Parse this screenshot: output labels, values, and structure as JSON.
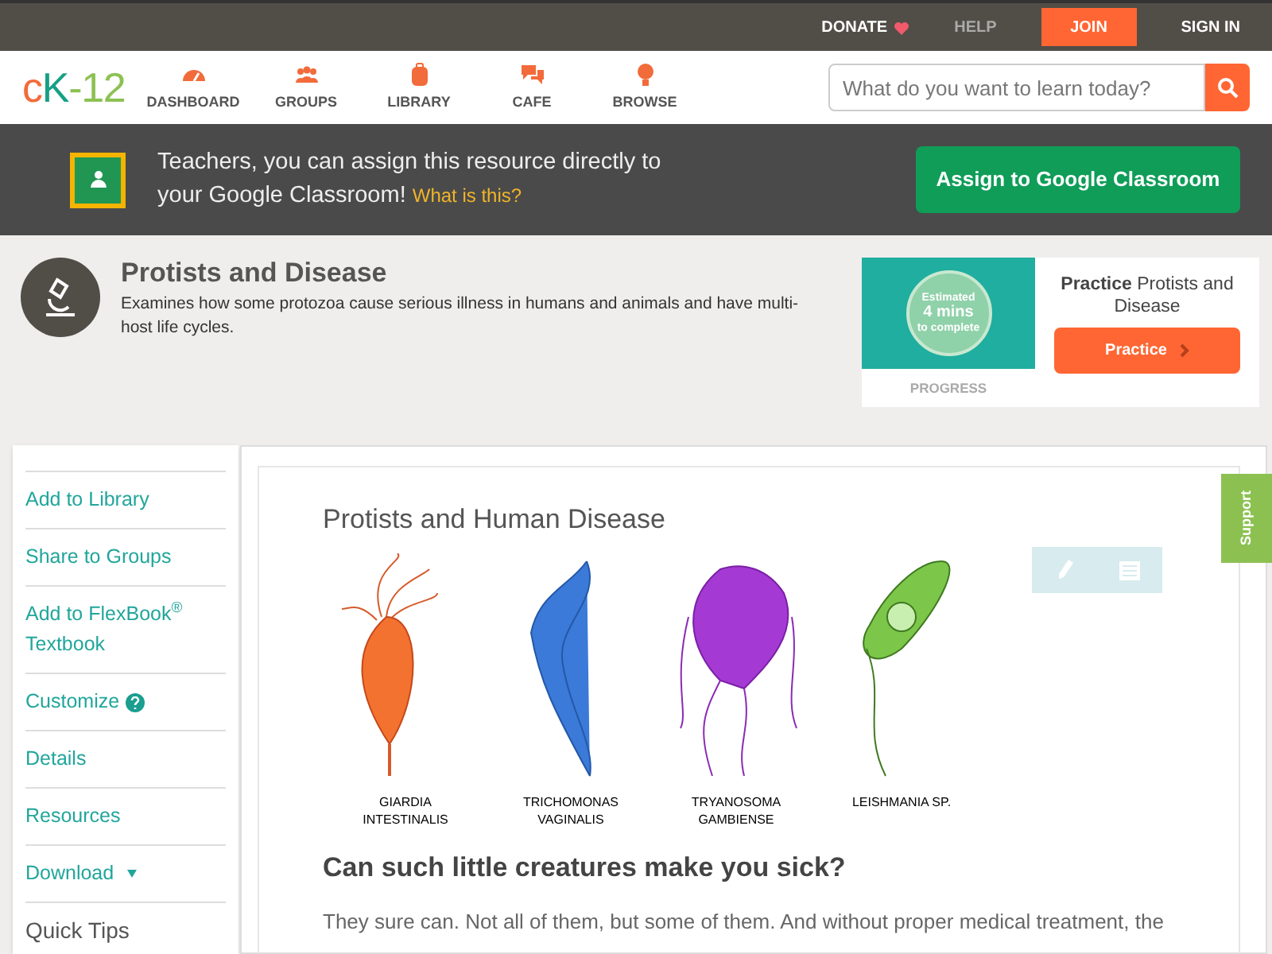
{
  "top_bar": {
    "links": [
      {
        "kind": "donate",
        "label": "DONATE"
      },
      {
        "kind": "help",
        "label": "HELP"
      },
      {
        "kind": "join",
        "label": "JOIN"
      },
      {
        "kind": "signin",
        "label": "SIGN IN"
      }
    ]
  },
  "nav": {
    "logo": [
      "c",
      "K",
      "-12"
    ],
    "items": [
      {
        "kind": "dashboard",
        "label": "DASHBOARD"
      },
      {
        "kind": "groups",
        "label": "GROUPS"
      },
      {
        "kind": "library",
        "label": "LIBRARY"
      },
      {
        "kind": "cafe",
        "label": "CAFE"
      },
      {
        "kind": "browse",
        "label": "BROWSE"
      }
    ],
    "search": {
      "placeholder": "What do you want to learn today?"
    }
  },
  "classroom_banner": {
    "text": "Teachers, you can assign this resource directly to your Google Classroom!",
    "link": "What is this?",
    "button": "Assign to Google Classroom"
  },
  "concept": {
    "title": "Protists and Disease",
    "description": "Examines how some protozoa cause serious illness in humans and animals and have multi-host life cycles."
  },
  "practice": {
    "estimate": [
      "Estimated",
      "4 mins",
      "to complete"
    ],
    "progress": "PROGRESS",
    "heading": "**Practice** Protists and Disease",
    "button": "Practice"
  },
  "sidebar": {
    "items": [
      {
        "kind": "link",
        "label": "Add to Library"
      },
      {
        "kind": "link",
        "label": "Share to Groups"
      },
      {
        "kind": "link",
        "label": "Add to FlexBook$^{®}$ Textbook"
      },
      {
        "kind": "help",
        "label": "Customize"
      },
      {
        "kind": "link",
        "label": "Details"
      },
      {
        "kind": "link",
        "label": "Resources"
      },
      {
        "kind": "dropdown",
        "label": "Download"
      },
      {
        "kind": "plain",
        "label": "Quick Tips"
      }
    ]
  },
  "article": {
    "title": "Protists and Human Disease",
    "figure_labels": [
      [
        "GIARDIA",
        "INTESTINALIS"
      ],
      [
        "TRICHOMONAS",
        "VAGINALIS"
      ],
      [
        "TRYANOSOMA",
        "GAMBIENSE"
      ],
      [
        "LEISHMANIA SP."
      ]
    ],
    "heading": "Can such little creatures make you sick?",
    "paragraph": "They sure can. Not all of them, but some of them. And without proper medical treatment, the"
  },
  "support_tab": "Support"
}
